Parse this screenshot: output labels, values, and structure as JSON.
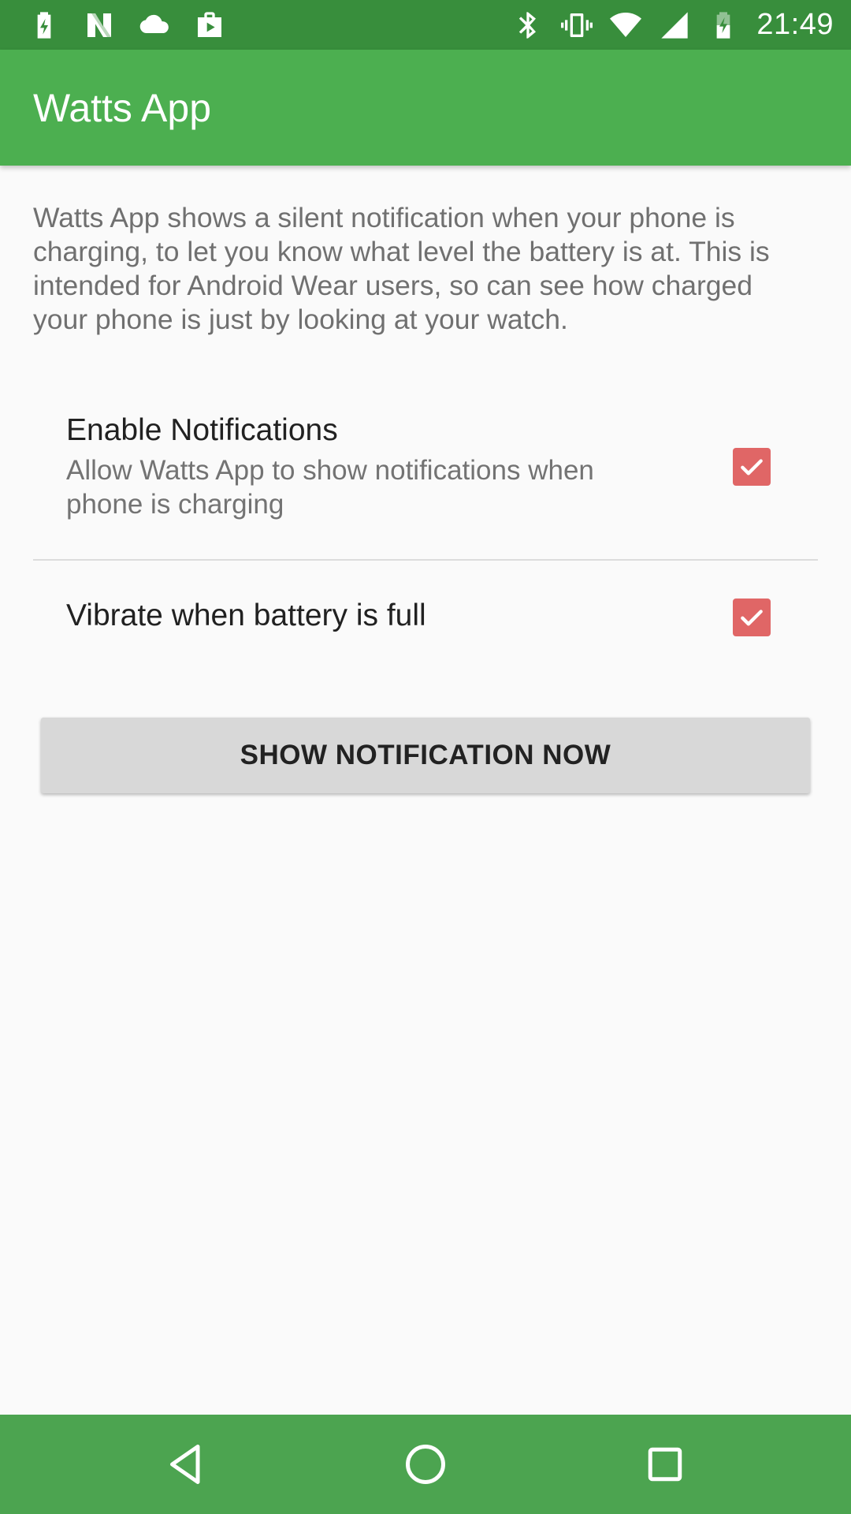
{
  "status_bar": {
    "time": "21:49",
    "left_icons": [
      "battery-charging-icon",
      "n-logo-icon",
      "cloud-icon",
      "shopping-bag-icon"
    ],
    "right_icons": [
      "bluetooth-icon",
      "vibrate-icon",
      "wifi-icon",
      "cell-signal-icon",
      "battery-icon"
    ]
  },
  "app_bar": {
    "title": "Watts App"
  },
  "description": "Watts App shows a silent notification when your phone is charging, to let you know what level the battery is at. This is intended for Android Wear users, so can see how charged your phone is just by looking at your watch.",
  "preferences": [
    {
      "title": "Enable Notifications",
      "summary": "Allow Watts App to show notifications when phone is charging",
      "checked": true
    },
    {
      "title": "Vibrate when battery is full",
      "summary": "",
      "checked": true
    }
  ],
  "action_button": {
    "label": "SHOW NOTIFICATION NOW"
  },
  "nav_bar": {
    "buttons": [
      "back-icon",
      "home-icon",
      "recents-icon"
    ]
  },
  "colors": {
    "status_bar": "#388e3c",
    "app_bar": "#4caf50",
    "nav_bar": "#4ca450",
    "checkbox": "#e06666",
    "button": "#d8d8d8"
  }
}
